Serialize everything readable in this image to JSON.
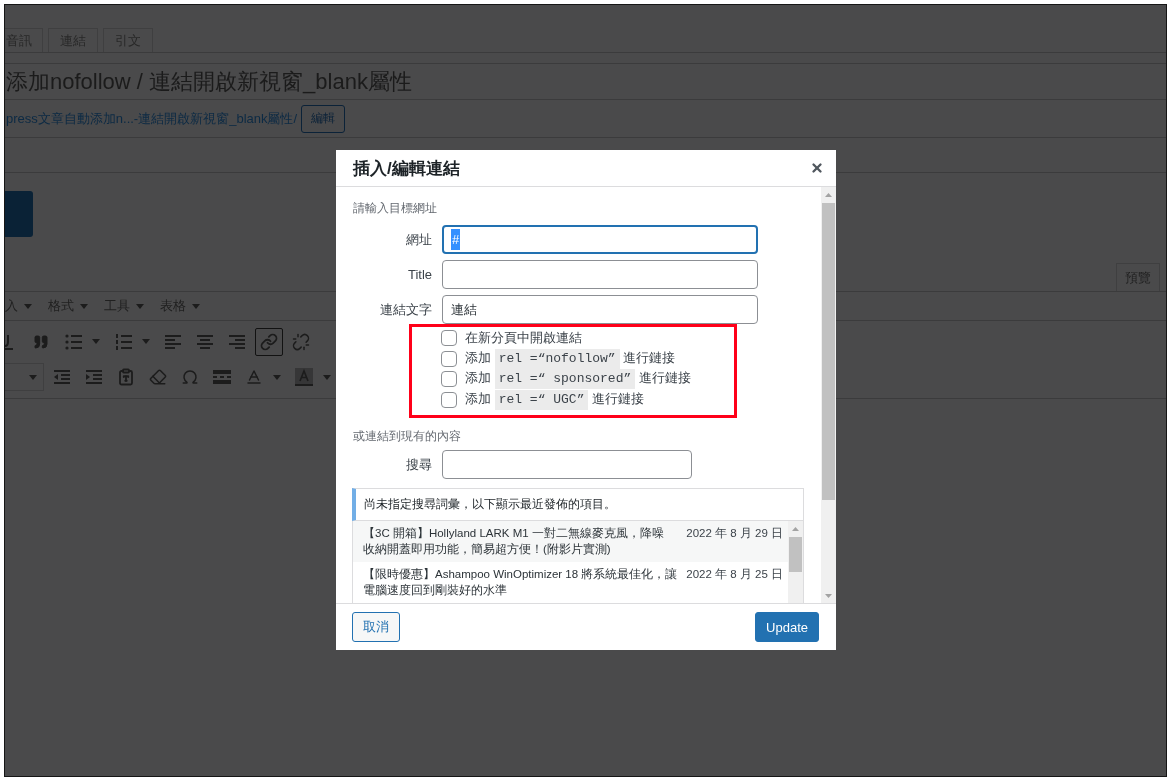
{
  "editor": {
    "format_tabs": [
      "音訊",
      "連結",
      "引文"
    ],
    "post_title": "添加nofollow / 連結開啟新視窗_blank屬性",
    "permalink": {
      "link": "press文章自動添加n...-連結開啟新視窗_blank屬性/",
      "edit_button": "編輯"
    },
    "preview_tab": "預覽",
    "menu": [
      "入",
      "格式",
      "工具",
      "表格"
    ],
    "toolbar": {
      "link_active": true
    }
  },
  "dialog": {
    "title": "插入/編輯連結",
    "url_heading": "請輸入目標網址",
    "fields": [
      {
        "label": "網址",
        "value": "#",
        "focused": true,
        "text_selected": true
      },
      {
        "label": "Title",
        "focused": false
      },
      {
        "label": "連結文字",
        "value": "連結",
        "focused": false,
        "text_selected": false
      }
    ],
    "link_options": [
      {
        "kind": "plain",
        "text": "在新分頁中開啟連結",
        "checked": false
      },
      {
        "kind": "code",
        "before": "添加",
        "code": "rel =“nofollow”",
        "after": "進行鏈接",
        "checked": false
      },
      {
        "kind": "code",
        "before": "添加",
        "code": "rel =“ sponsored”",
        "after": "進行鏈接",
        "checked": false
      },
      {
        "kind": "code",
        "before": "添加",
        "code": "rel =“ UGC”",
        "after": "進行鏈接",
        "checked": false
      }
    ],
    "existing_heading": "或連結到現有的內容",
    "search": {
      "label": "搜尋"
    },
    "notice": "尚未指定搜尋詞彙，以下顯示最近發佈的項目。",
    "results": [
      {
        "title_lines": [
          "【3C 開箱】Hollyland LARK M1 一對二無線麥克風，降噪",
          "收納開蓋即用功能，簡易超方便！(附影片實測)"
        ],
        "date": "2022 年 8 月 29 日"
      },
      {
        "title_lines": [
          "【限時優惠】Ashampoo WinOptimizer 18 將系統最佳化，讓",
          "電腦速度回到剛裝好的水準"
        ],
        "date": "2022 年 8 月 25 日"
      }
    ],
    "buttons": {
      "cancel": "取消",
      "submit": "Update"
    }
  }
}
